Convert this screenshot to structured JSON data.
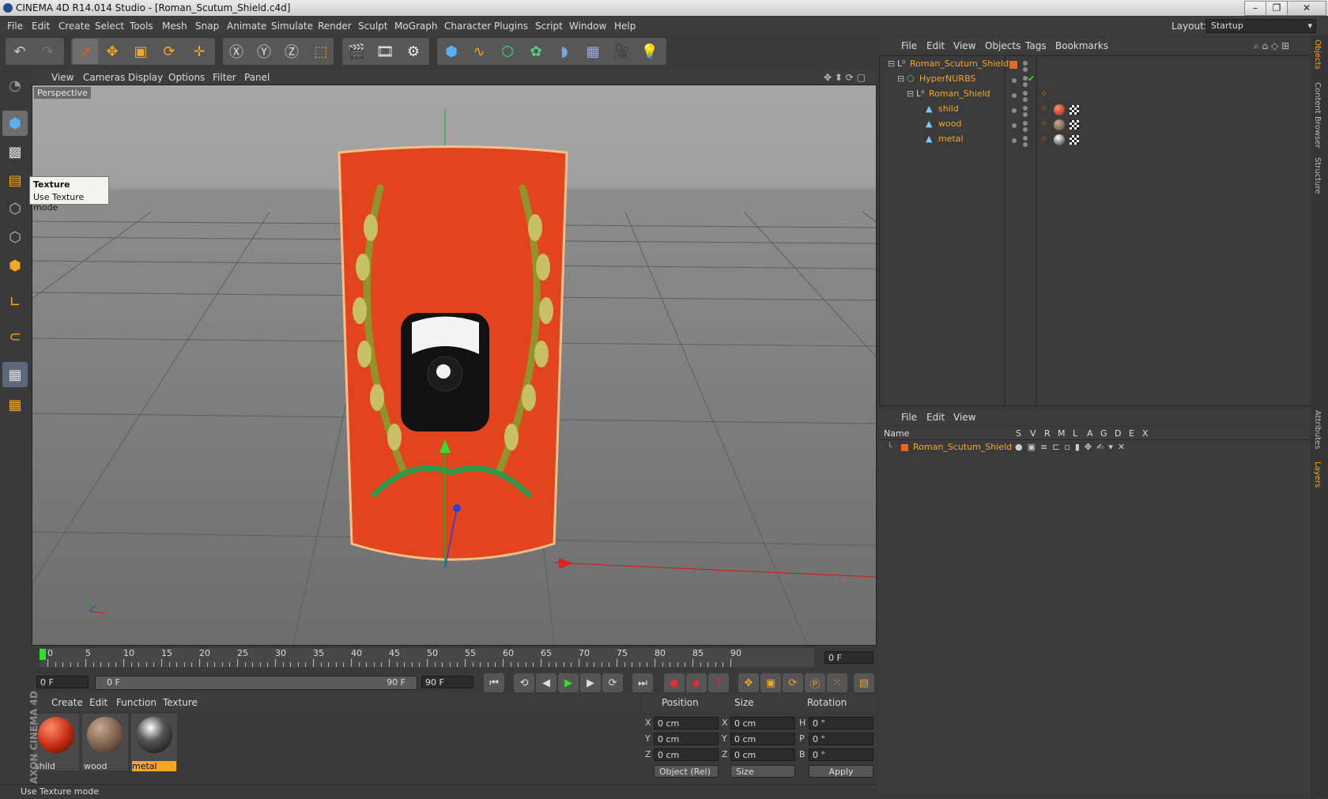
{
  "window": {
    "title": "CINEMA 4D R14.014 Studio - [Roman_Scutum_Shield.c4d]",
    "buttons": [
      "–",
      "❐",
      "✕"
    ]
  },
  "menubar": {
    "items": [
      "File",
      "Edit",
      "Create",
      "Select",
      "Tools",
      "Mesh",
      "Snap",
      "Animate",
      "Simulate",
      "Render",
      "Sculpt",
      "MoGraph",
      "Character",
      "Plugins",
      "Script",
      "Window",
      "Help"
    ],
    "layout_label": "Layout:",
    "layout_value": "Startup"
  },
  "viewport": {
    "menu": [
      "View",
      "Cameras",
      "Display",
      "Options",
      "Filter",
      "Panel"
    ],
    "camera_label": "Perspective"
  },
  "tooltip": {
    "title": "Texture",
    "text": "Use Texture mode"
  },
  "timeline": {
    "ticks": [
      "0",
      "5",
      "10",
      "15",
      "20",
      "25",
      "30",
      "35",
      "40",
      "45",
      "50",
      "55",
      "60",
      "65",
      "70",
      "75",
      "80",
      "85",
      "90"
    ],
    "current_frame": "0 F"
  },
  "transport": {
    "start": "0 F",
    "range_start": "0 F",
    "range_end": "90 F",
    "end": "90 F"
  },
  "material_manager": {
    "menu": [
      "Create",
      "Edit",
      "Function",
      "Texture"
    ],
    "materials": [
      {
        "name": "shild",
        "selected": false
      },
      {
        "name": "wood",
        "selected": false
      },
      {
        "name": "metal",
        "selected": true
      }
    ]
  },
  "coordinates": {
    "headers": [
      "Position",
      "Size",
      "Rotation"
    ],
    "rows": [
      {
        "axis": "X",
        "pos": "0 cm",
        "size_axis": "X",
        "size": "0 cm",
        "rot_axis": "H",
        "rot": "0 °"
      },
      {
        "axis": "Y",
        "pos": "0 cm",
        "size_axis": "Y",
        "size": "0 cm",
        "rot_axis": "P",
        "rot": "0 °"
      },
      {
        "axis": "Z",
        "pos": "0 cm",
        "size_axis": "Z",
        "size": "0 cm",
        "rot_axis": "B",
        "rot": "0 °"
      }
    ],
    "mode": "Object (Rel)",
    "size_mode": "Size",
    "apply": "Apply"
  },
  "status": "Use Texture mode",
  "branding": "MAXON CINEMA 4D",
  "object_manager": {
    "menu": [
      "File",
      "Edit",
      "View",
      "Objects",
      "Tags",
      "Bookmarks"
    ],
    "objects": [
      {
        "name": "Roman_Scutum_Shield",
        "indent": 0
      },
      {
        "name": "HyperNURBS",
        "indent": 1
      },
      {
        "name": "Roman_Shield",
        "indent": 2
      },
      {
        "name": "shild",
        "indent": 3
      },
      {
        "name": "wood",
        "indent": 3
      },
      {
        "name": "metal",
        "indent": 3
      }
    ]
  },
  "layer_manager": {
    "menu": [
      "File",
      "Edit",
      "View"
    ],
    "columns": [
      "Name",
      "S",
      "V",
      "R",
      "M",
      "L",
      "A",
      "G",
      "D",
      "E",
      "X"
    ],
    "layers": [
      {
        "name": "Roman_Scutum_Shield"
      }
    ]
  },
  "side_tabs": [
    "Objects",
    "Content Browser",
    "Structure",
    "Attributes",
    "Layers"
  ],
  "colors": {
    "accent": "#f39a1e",
    "selection": "#f5a623",
    "shield": "#e2441d"
  }
}
